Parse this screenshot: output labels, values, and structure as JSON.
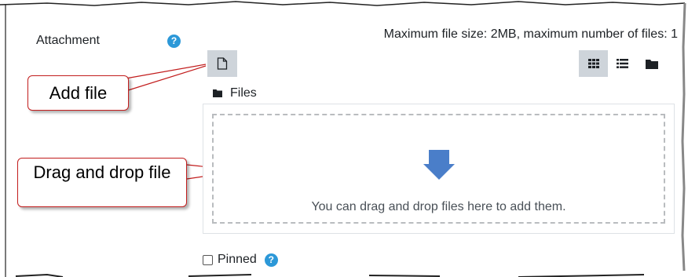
{
  "attachment": {
    "label": "Attachment",
    "help_icon": "question-circle-icon",
    "limits_text": "Maximum file size: 2MB, maximum number of files: 1"
  },
  "filepicker": {
    "add_file_icon": "file-icon",
    "view_modes": [
      {
        "icon": "grid-icon",
        "active": true
      },
      {
        "icon": "list-icon",
        "active": false
      },
      {
        "icon": "folder-icon",
        "active": false
      }
    ],
    "path_icon": "folder-icon",
    "path_label": "Files",
    "drop_icon": "down-arrow-icon",
    "drop_text": "You can drag and drop files here to add them."
  },
  "annotations": {
    "add_file": "Add file",
    "drag_drop": "Drag and drop file"
  },
  "pinned": {
    "label": "Pinned",
    "checked": false,
    "help_icon": "question-circle-icon"
  },
  "colors": {
    "help": "#2c98d8",
    "arrow": "#4a7ec9",
    "callout_border": "#c21d1d",
    "button_bg": "#ced4da"
  }
}
